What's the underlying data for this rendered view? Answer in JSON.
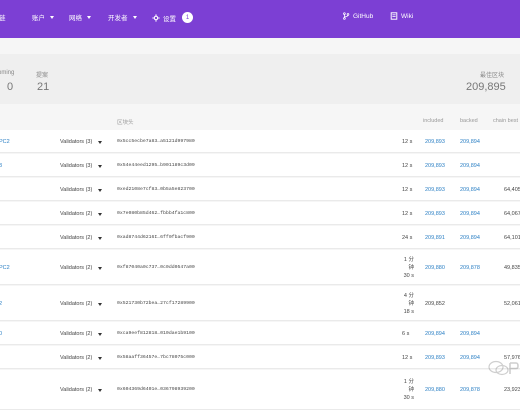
{
  "nav": {
    "brand_fragment": "链",
    "accounts": "账户",
    "network": "网络",
    "developer": "开发者",
    "settings": "设置",
    "settings_badge": "1",
    "github": "GitHub",
    "wiki": "Wiki"
  },
  "summary": {
    "upcoming_label": "oming",
    "upcoming_value": "0",
    "proposed_label": "提案",
    "proposed_value": "21",
    "latest_label": "最佳区块",
    "latest_value": "209,895"
  },
  "table": {
    "headers": {
      "block_hash": "区块头",
      "included": "included",
      "backed": "backed",
      "chain_best": "chain best"
    },
    "rows": [
      {
        "name": "PC2",
        "validators": "Validators (3)",
        "hash": "0x5cc5ecbe7a83…a5121d997980",
        "age1": "12 s",
        "age2": "",
        "age3": "",
        "included": "209,893",
        "backed": "209,894",
        "best": ""
      },
      {
        "name": "3",
        "validators": "Validators (3)",
        "hash": "0x54e44eed1295…b901189c3d09",
        "age1": "12 s",
        "age2": "",
        "age3": "",
        "included": "209,893",
        "backed": "209,894",
        "best": ""
      },
      {
        "name": "",
        "validators": "Validators (3)",
        "hash": "0xed2108e7cf83…0b5a5e823700",
        "age1": "12 s",
        "age2": "",
        "age3": "",
        "included": "209,893",
        "backed": "209,894",
        "best": "64,405"
      },
      {
        "name": "",
        "validators": "Validators (2)",
        "hash": "0x7e080b85d462…fbbb4fa1c800",
        "age1": "12 s",
        "age2": "",
        "age3": "",
        "included": "209,893",
        "backed": "209,894",
        "best": "64,067"
      },
      {
        "name": "",
        "validators": "Validators (2)",
        "hash": "0xad8744d6216I…6ff0fbacf900",
        "age1": "24 s",
        "age2": "",
        "age3": "",
        "included": "209,891",
        "backed": "209,894",
        "best": "64,101"
      },
      {
        "name": "PC2",
        "validators": "Validators (2)",
        "hash": "0xf87040a0c737…0c0dd0547a00",
        "age1": "1 分",
        "age2": "钟",
        "age3": "30 s",
        "included": "209,880",
        "backed": "209,878",
        "best": "49,835"
      },
      {
        "name": "2",
        "validators": "Validators (2)",
        "hash": "0x521730b72bea…27cf17289900",
        "age1": "4 分",
        "age2": "钟",
        "age3": "18 s",
        "included": "209,852",
        "backed": "",
        "best": "52,061"
      },
      {
        "name": "0",
        "validators": "Validators (2)",
        "hash": "0xca9eef812818…010dae1b9100",
        "age1": "6 s",
        "age2": "",
        "age3": "",
        "included": "209,894",
        "backed": "209,894",
        "best": ""
      },
      {
        "name": "",
        "validators": "Validators (2)",
        "hash": "0x58aaff36457e…7bc78075c000",
        "age1": "12 s",
        "age2": "",
        "age3": "",
        "included": "209,893",
        "backed": "209,894",
        "best": "57,976"
      },
      {
        "name": "",
        "validators": "Validators (2)",
        "hash": "0x604369d6401e…036798939200",
        "age1": "1 分",
        "age2": "钟",
        "age3": "30 s",
        "included": "209,880",
        "backed": "209,878",
        "best": "23,923"
      }
    ]
  }
}
